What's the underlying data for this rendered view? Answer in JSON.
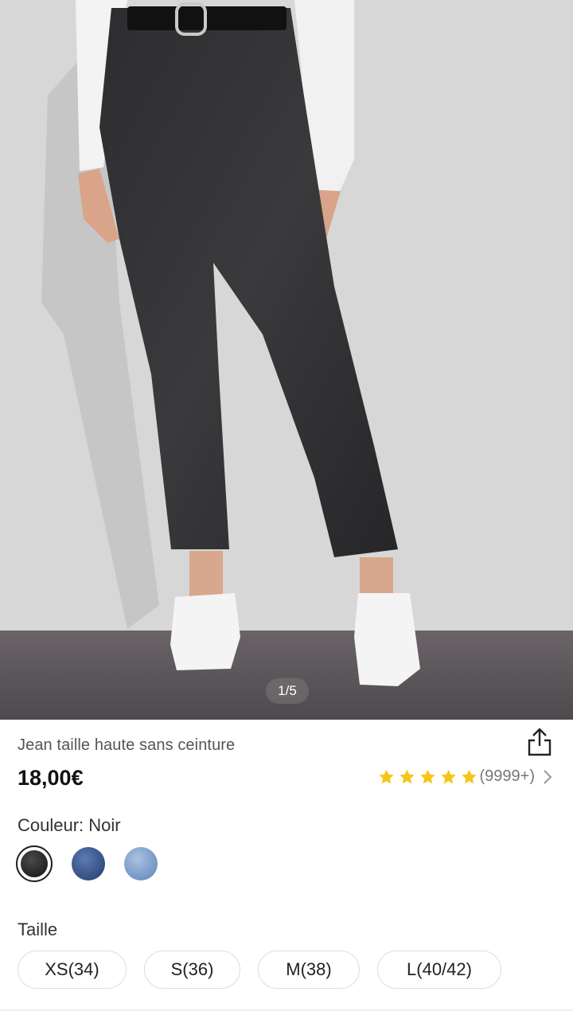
{
  "gallery": {
    "counter": "1/5",
    "image_subject": "black high-waist jeans worn with white sneakers"
  },
  "product": {
    "title": "Jean taille haute sans ceinture",
    "price": "18,00€",
    "rating": {
      "stars": 5,
      "reviews": "(9999+)"
    },
    "share_icon": "share-icon"
  },
  "color": {
    "label": "Couleur: Noir",
    "options": [
      {
        "name": "Noir",
        "hex": "#2b2b2b",
        "selected": true
      },
      {
        "name": "Bleu",
        "hex": "#3e5b92",
        "selected": false
      },
      {
        "name": "Bleu clair",
        "hex": "#8aa8d2",
        "selected": false
      }
    ]
  },
  "size": {
    "label": "Taille",
    "options": [
      "XS(34)",
      "S(36)",
      "M(38)",
      "L(40/42)"
    ]
  },
  "colors": {
    "star": "#f5c518",
    "text": "#222222",
    "muted": "#777777"
  }
}
